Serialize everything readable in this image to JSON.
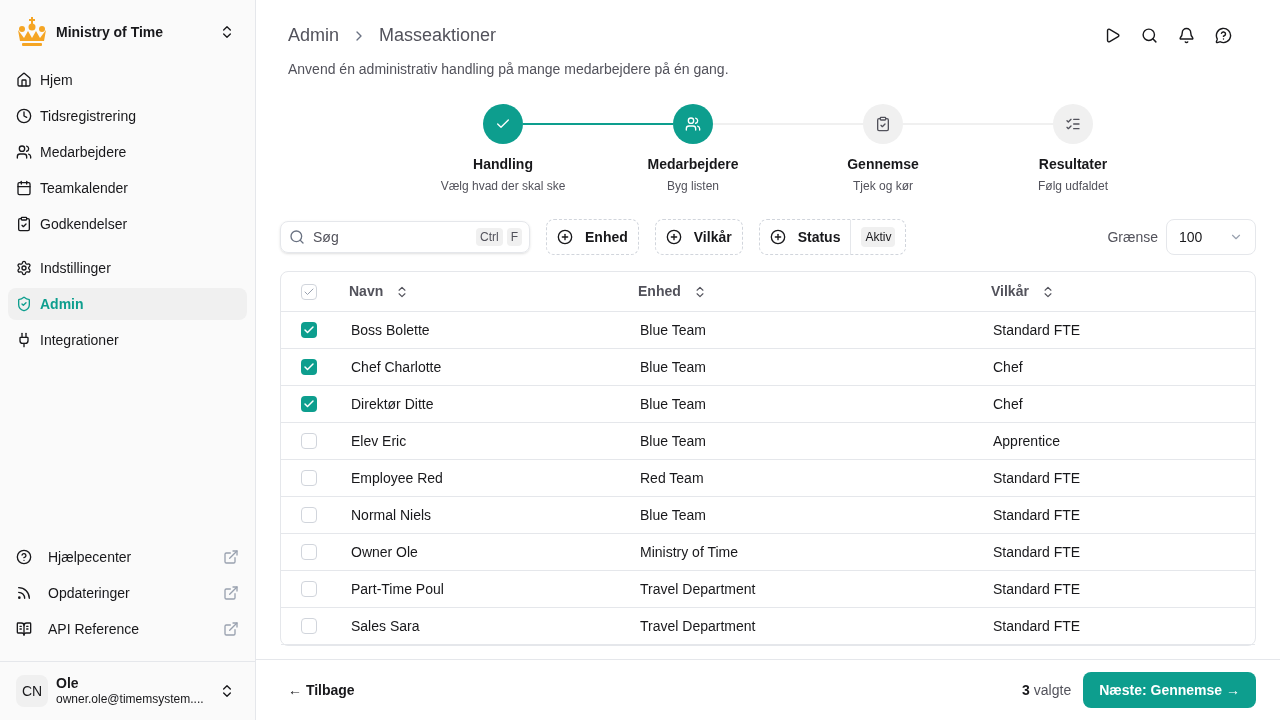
{
  "sidebar": {
    "org": "Ministry of Time",
    "items": [
      {
        "label": "Hjem",
        "selected": false
      },
      {
        "label": "Tidsregistrering",
        "selected": false
      },
      {
        "label": "Medarbejdere",
        "selected": false
      },
      {
        "label": "Teamkalender",
        "selected": false
      },
      {
        "label": "Godkendelser",
        "selected": false
      },
      {
        "label": "Indstillinger",
        "selected": false
      },
      {
        "label": "Admin",
        "selected": true
      },
      {
        "label": "Integrationer",
        "selected": false
      }
    ],
    "links": [
      {
        "label": "Hjælpecenter"
      },
      {
        "label": "Opdateringer"
      },
      {
        "label": "API Reference"
      }
    ],
    "user": {
      "initials": "CN",
      "name": "Ole",
      "email": "owner.ole@timemsystem...."
    }
  },
  "breadcrumb": [
    "Admin",
    "Masseaktioner"
  ],
  "subtitle": "Anvend én administrativ handling på mange medarbejdere på én gang.",
  "steps": [
    {
      "title": "Handling",
      "caption": "Vælg hvad der skal ske",
      "reached": true
    },
    {
      "title": "Medarbejdere",
      "caption": "Byg listen",
      "reached": true
    },
    {
      "title": "Gennemse",
      "caption": "Tjek og kør",
      "reached": false
    },
    {
      "title": "Resultater",
      "caption": "Følg udfaldet",
      "reached": false
    }
  ],
  "search": {
    "placeholder": "Søg",
    "keys": [
      "Ctrl",
      "F"
    ]
  },
  "filters": [
    {
      "label": "Enhed"
    },
    {
      "label": "Vilkår"
    },
    {
      "label": "Status",
      "value": "Aktiv"
    }
  ],
  "limit": {
    "label": "Grænse",
    "value": "100"
  },
  "table": {
    "select_all": {
      "indeterminate": true
    },
    "columns": [
      "Navn",
      "Enhed",
      "Vilkår"
    ],
    "rows": [
      {
        "checked": true,
        "cells": [
          "Boss Bolette",
          "Blue Team",
          "Standard FTE"
        ]
      },
      {
        "checked": true,
        "cells": [
          "Chef Charlotte",
          "Blue Team",
          "Chef"
        ]
      },
      {
        "checked": true,
        "cells": [
          "Direktør Ditte",
          "Blue Team",
          "Chef"
        ]
      },
      {
        "checked": false,
        "cells": [
          "Elev Eric",
          "Blue Team",
          "Apprentice"
        ]
      },
      {
        "checked": false,
        "cells": [
          "Employee Red",
          "Red Team",
          "Standard FTE"
        ]
      },
      {
        "checked": false,
        "cells": [
          "Normal Niels",
          "Blue Team",
          "Standard FTE"
        ]
      },
      {
        "checked": false,
        "cells": [
          "Owner Ole",
          "Ministry of Time",
          "Standard FTE"
        ]
      },
      {
        "checked": false,
        "cells": [
          "Part-Time Poul",
          "Travel Department",
          "Standard FTE"
        ]
      },
      {
        "checked": false,
        "cells": [
          "Sales Sara",
          "Travel Department",
          "Standard FTE"
        ]
      }
    ]
  },
  "footer": {
    "back": "← Tilbage",
    "count": "3",
    "count_label": "valgte",
    "next": "Næste: Gennemse →"
  }
}
